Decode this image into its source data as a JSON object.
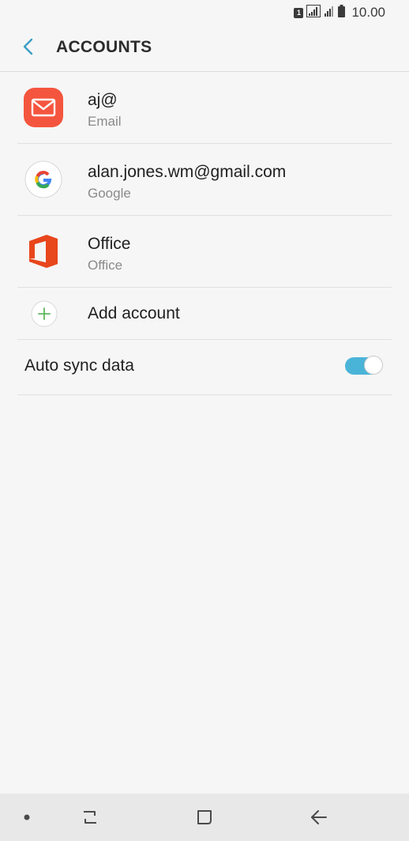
{
  "status_bar": {
    "sim_label": "1",
    "time": "10.00"
  },
  "header": {
    "title": "ACCOUNTS"
  },
  "accounts": [
    {
      "title": "aj@",
      "subtitle": "Email",
      "icon": "email-icon",
      "color": "#f4553e"
    },
    {
      "title": "alan.jones.wm@gmail.com",
      "subtitle": "Google",
      "icon": "google-icon"
    },
    {
      "title": "Office",
      "subtitle": "Office",
      "icon": "office-icon",
      "color": "#e8461c"
    }
  ],
  "add_account": {
    "label": "Add account",
    "icon": "plus-icon",
    "color": "#5cb85c"
  },
  "sync": {
    "label": "Auto sync data",
    "enabled": true,
    "accent": "#4ab4d8"
  },
  "nav": {
    "items": [
      "dot-icon",
      "recents-icon",
      "home-icon",
      "back-icon"
    ]
  }
}
